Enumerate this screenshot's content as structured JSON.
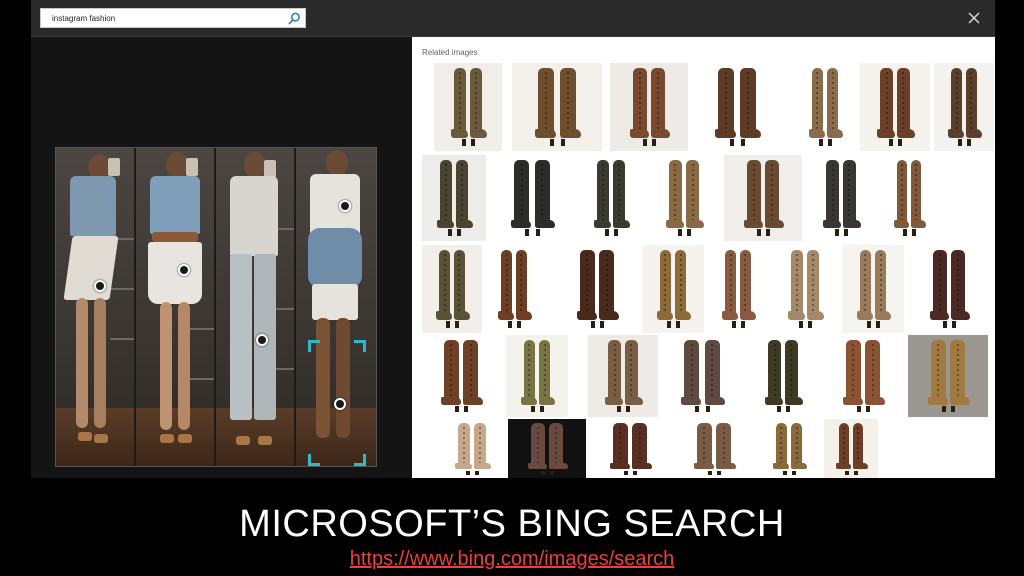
{
  "search": {
    "query": "instagram fashion",
    "icon": "search-icon"
  },
  "window": {
    "close_icon": "close-icon"
  },
  "related": {
    "title": "Related images",
    "thumbnails": [
      {
        "row": 0,
        "col": 0,
        "shade": "#6a5a3c",
        "bg": "#f1eeea"
      },
      {
        "row": 0,
        "col": 1,
        "shade": "#6e4e2c",
        "bg": "#f3f0ec"
      },
      {
        "row": 0,
        "col": 2,
        "shade": "#7a4a2e",
        "bg": "#eeeae6"
      },
      {
        "row": 0,
        "col": 3,
        "shade": "#5e3b26",
        "bg": "#ffffff"
      },
      {
        "row": 0,
        "col": 4,
        "shade": "#8c6b4a",
        "bg": "#ffffff"
      },
      {
        "row": 0,
        "col": 5,
        "shade": "#6b3f28",
        "bg": "#f6f3ef"
      },
      {
        "row": 0,
        "col": 6,
        "shade": "#5b3f2d",
        "bg": "#f4f2ee"
      },
      {
        "row": 1,
        "col": 0,
        "shade": "#4a4330",
        "bg": "#eeece8"
      },
      {
        "row": 1,
        "col": 1,
        "shade": "#2e2c2a",
        "bg": "#ffffff"
      },
      {
        "row": 1,
        "col": 2,
        "shade": "#3b3a2e",
        "bg": "#ffffff"
      },
      {
        "row": 1,
        "col": 3,
        "shade": "#8a6a44",
        "bg": "#ffffff"
      },
      {
        "row": 1,
        "col": 4,
        "shade": "#6a4a30",
        "bg": "#f0eeea"
      },
      {
        "row": 1,
        "col": 5,
        "shade": "#3a3634",
        "bg": "#ffffff"
      },
      {
        "row": 1,
        "col": 6,
        "shade": "#7e5a3a",
        "bg": "#ffffff"
      },
      {
        "row": 2,
        "col": 0,
        "shade": "#5a5236",
        "bg": "#f2efea"
      },
      {
        "row": 2,
        "col": 1,
        "shade": "#6e3e22",
        "bg": "#ffffff"
      },
      {
        "row": 2,
        "col": 2,
        "shade": "#4a2a1c",
        "bg": "#ffffff"
      },
      {
        "row": 2,
        "col": 3,
        "shade": "#8c6a3a",
        "bg": "#f6f3ee"
      },
      {
        "row": 2,
        "col": 4,
        "shade": "#8a5a40",
        "bg": "#ffffff"
      },
      {
        "row": 2,
        "col": 5,
        "shade": "#a5886a",
        "bg": "#ffffff"
      },
      {
        "row": 2,
        "col": 6,
        "shade": "#9a7a5a",
        "bg": "#f6f4f0"
      },
      {
        "row": 2,
        "col": 7,
        "shade": "#4a2a22",
        "bg": "#ffffff"
      },
      {
        "row": 3,
        "col": 0,
        "shade": "#6e4026",
        "bg": "#ffffff"
      },
      {
        "row": 3,
        "col": 1,
        "shade": "#7a7444",
        "bg": "#f4f2ec"
      },
      {
        "row": 3,
        "col": 2,
        "shade": "#7a5e44",
        "bg": "#eeebe6"
      },
      {
        "row": 3,
        "col": 3,
        "shade": "#5e4a3e",
        "bg": "#ffffff"
      },
      {
        "row": 3,
        "col": 4,
        "shade": "#3e3a24",
        "bg": "#ffffff"
      },
      {
        "row": 3,
        "col": 5,
        "shade": "#8a5432",
        "bg": "#ffffff"
      },
      {
        "row": 3,
        "col": 6,
        "shade": "#a07a40",
        "bg": "#9a9690"
      },
      {
        "row": 4,
        "col": 0,
        "shade": "#c8a88a",
        "bg": "#ffffff"
      },
      {
        "row": 4,
        "col": 1,
        "shade": "#6a4a40",
        "bg": "#111111"
      },
      {
        "row": 4,
        "col": 2,
        "shade": "#5a2e22",
        "bg": "#ffffff"
      },
      {
        "row": 4,
        "col": 3,
        "shade": "#7a5c44",
        "bg": "#ffffff"
      },
      {
        "row": 4,
        "col": 4,
        "shade": "#8a6a3a",
        "bg": "#ffffff"
      },
      {
        "row": 4,
        "col": 5,
        "shade": "#6e3e26",
        "bg": "#f4f0ea"
      }
    ]
  },
  "caption": {
    "title": "MICROSOFT’S BING SEARCH",
    "link": "https://www.bing.com/images/search"
  },
  "colors": {
    "crop_accent": "#2fb8c8",
    "link": "#e8403a"
  }
}
